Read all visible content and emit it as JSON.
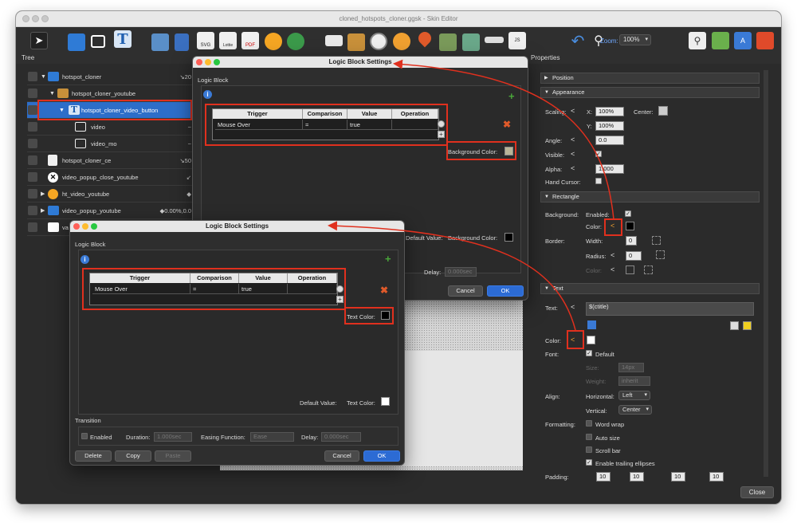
{
  "window": {
    "title": "cloned_hotspots_cloner.ggsk - Skin Editor"
  },
  "toolbar": {
    "icons": [
      "pointer-icon",
      "container-icon",
      "rectangle-icon",
      "text-icon",
      "image-icon",
      "cloner-icon",
      "svg-icon",
      "lottie-icon",
      "pdf-icon",
      "hotspot-icon",
      "map-icon",
      "list-icon",
      "grid-icon",
      "timer-icon",
      "target-icon",
      "location-icon",
      "video-icon",
      "movie-icon",
      "bar-icon",
      "code-icon",
      "undo-icon",
      "zoom-icon"
    ],
    "svg_label": "SVG",
    "lottie_label": "Lottie",
    "pdf_label": "PDF",
    "js_label": "JS",
    "zoom_label": "Zoom:",
    "zoom_value": "100%"
  },
  "tree": {
    "title": "Tree",
    "rows": [
      {
        "label": "hotspot_cloner",
        "value": "↘20"
      },
      {
        "label": "hotspot_cloner_youtube",
        "value": ""
      },
      {
        "label": "hotspot_cloner_video_button",
        "value": ""
      },
      {
        "label": "video",
        "value": "~"
      },
      {
        "label": "video_mo",
        "value": "~"
      },
      {
        "label": "hotspot_cloner_ce",
        "value": "↘50"
      },
      {
        "label": "video_popup_close_youtube",
        "value": "↙"
      },
      {
        "label": "ht_video_youtube",
        "value": "◆"
      },
      {
        "label": "video_popup_youtube",
        "value": "◆0.00%,0.0"
      },
      {
        "label": "va",
        "value": ""
      }
    ]
  },
  "properties": {
    "title": "Properties",
    "sections": {
      "position": "Position",
      "appearance": "Appearance",
      "rectangle": "Rectangle",
      "text": "Text"
    },
    "scaling_label": "Scaling:",
    "x_label": "X:",
    "x_value": "100%",
    "y_label": "Y:",
    "y_value": "100%",
    "center_label": "Center:",
    "angle_label": "Angle:",
    "angle_value": "0.0",
    "visible_label": "Visible:",
    "alpha_label": "Alpha:",
    "alpha_value": "1.000",
    "hand_cursor_label": "Hand Cursor:",
    "background_label": "Background:",
    "enabled_label": "Enabled:",
    "color_label": "Color:",
    "border_label": "Border:",
    "width_label": "Width:",
    "border_width": "0",
    "radius_label": "Radius:",
    "radius_value": "0",
    "text_label": "Text:",
    "text_value": "$(ctitle)",
    "text_color_label": "Color:",
    "font_label": "Font:",
    "default_label": "Default",
    "size_label": "Size:",
    "size_value": "14px",
    "weight_label": "Weight:",
    "weight_value": "inherit",
    "align_label": "Align:",
    "horizontal_label": "Horizontal:",
    "horizontal_value": "Left",
    "vertical_label": "Vertical:",
    "vertical_value": "Center",
    "formatting_label": "Formatting:",
    "word_wrap": "Word wrap",
    "auto_size": "Auto size",
    "scroll_bar": "Scroll bar",
    "trailing": "Enable trailing ellipses",
    "padding_label": "Padding:",
    "padding_values": [
      "10",
      "10",
      "10",
      "10"
    ],
    "colors": {
      "rect_background": "#000000",
      "text_color": "#ffffff"
    }
  },
  "close_button": "Close",
  "dialog1": {
    "title": "Logic Block Settings",
    "section": "Logic Block",
    "headers": [
      "Trigger",
      "Comparison",
      "Value",
      "Operation"
    ],
    "row": [
      "Mouse Over",
      "=",
      "true",
      ""
    ],
    "property_label": "Background Color:",
    "default_value_label": "Default Value:",
    "default_property_label": "Background Color:",
    "delay_label": "Delay:",
    "delay_value": "0.000sec",
    "cancel": "Cancel",
    "ok": "OK",
    "colors": {
      "property_swatch": "#b9b497",
      "default_swatch": "#000000"
    }
  },
  "dialog2": {
    "title": "Logic Block Settings",
    "section": "Logic Block",
    "headers": [
      "Trigger",
      "Comparison",
      "Value",
      "Operation"
    ],
    "row": [
      "Mouse Over",
      "=",
      "true",
      ""
    ],
    "property_label": "Text Color:",
    "default_value_label": "Default Value:",
    "default_property_label": "Text Color:",
    "transition_label": "Transition",
    "enabled_label": "Enabled",
    "duration_label": "Duration:",
    "duration_value": "1.000sec",
    "easing_label": "Easing Function:",
    "easing_value": "Ease",
    "delay_label": "Delay:",
    "delay_value": "0.000sec",
    "delete": "Delete",
    "copy": "Copy",
    "paste": "Paste",
    "cancel": "Cancel",
    "ok": "OK",
    "colors": {
      "property_swatch": "#000000",
      "default_swatch": "#ffffff"
    }
  },
  "accent_colors": {
    "annotation_red": "#e0301e",
    "selection_blue": "#2d6ec9",
    "button_blue": "#2c6bd4"
  }
}
